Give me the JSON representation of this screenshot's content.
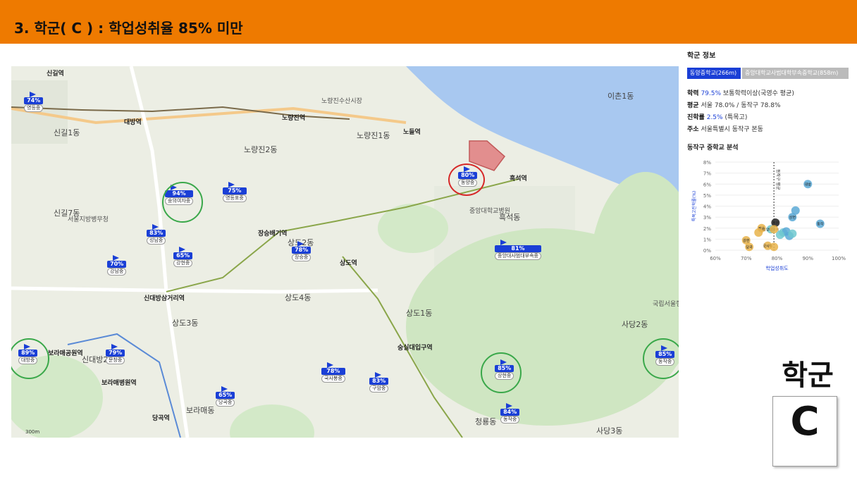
{
  "title": "3. 학군( C ) : 학업성취율 85% 미만",
  "map": {
    "scale_label": "300m",
    "places": [
      {
        "t": "신길역"
      },
      {
        "t": "대방역"
      },
      {
        "t": "노량진역"
      },
      {
        "t": "노들역"
      },
      {
        "t": "흑석역"
      },
      {
        "t": "장승배기역"
      },
      {
        "t": "상도역"
      },
      {
        "t": "신대방삼거리역"
      },
      {
        "t": "숭실대입구역"
      },
      {
        "t": "보라매공원역"
      },
      {
        "t": "보라매병원역"
      },
      {
        "t": "당곡역"
      },
      {
        "t": "신길1동"
      },
      {
        "t": "신길7동"
      },
      {
        "t": "노량진1동"
      },
      {
        "t": "노량진2동"
      },
      {
        "t": "상도2동"
      },
      {
        "t": "상도3동"
      },
      {
        "t": "상도4동"
      },
      {
        "t": "상도1동"
      },
      {
        "t": "흑석동"
      },
      {
        "t": "사당2동"
      },
      {
        "t": "사당3동"
      },
      {
        "t": "청룡동"
      },
      {
        "t": "보라매동"
      },
      {
        "t": "신대방2동"
      },
      {
        "t": "이촌1동"
      },
      {
        "t": "국립서울현충원"
      },
      {
        "t": "서울지방병무청"
      },
      {
        "t": "중앙대학교병원"
      },
      {
        "t": "노량진수산시장"
      }
    ],
    "schools": [
      {
        "pct": "74%",
        "name": "영등중"
      },
      {
        "pct": "94%",
        "name": "숭의여자중"
      },
      {
        "pct": "75%",
        "name": "영등포중"
      },
      {
        "pct": "83%",
        "name": "성남중"
      },
      {
        "pct": "65%",
        "name": "강현중"
      },
      {
        "pct": "70%",
        "name": "강남중"
      },
      {
        "pct": "78%",
        "name": "장승중"
      },
      {
        "pct": "80%",
        "name": "동양중"
      },
      {
        "pct": "81%",
        "name": "중앙대사범대부속중"
      },
      {
        "pct": "89%",
        "name": "대방중"
      },
      {
        "pct": "79%",
        "name": "문창중"
      },
      {
        "pct": "65%",
        "name": "당곡중"
      },
      {
        "pct": "78%",
        "name": "국사봉중"
      },
      {
        "pct": "83%",
        "name": "구암중"
      },
      {
        "pct": "85%",
        "name": "상현중"
      },
      {
        "pct": "84%",
        "name": "동작중"
      },
      {
        "pct": "85%",
        "name": "동작중"
      }
    ]
  },
  "panel": {
    "heading": "학군 정보",
    "tab_active": "동양중학교(266m)",
    "tab_inactive": "중앙대학교사범대학부속중학교(858m)",
    "row1_label": "학력",
    "row1_value": "79.5%",
    "row1_rest": "보통학력이상(국영수 평균)",
    "row2_label": "평균",
    "row2_rest": "서울 78.0% / 동작구 78.8%",
    "row3_label": "진학률",
    "row3_value": "2.5%",
    "row3_rest": "(특목고)",
    "row4_label": "주소",
    "row4_rest": "서울특별시 동작구 본동",
    "scatter_title": "동작구 중학교 분석"
  },
  "chart_data": {
    "type": "scatter",
    "title": "동작구 중학교 분석",
    "xlabel": "학업성취도",
    "ylabel": "특목고진학률(%)",
    "xlim": [
      60,
      100
    ],
    "ylim": [
      0,
      8
    ],
    "x_ticks": [
      "60%",
      "70%",
      "80%",
      "90%",
      "100%"
    ],
    "y_ticks": [
      "0%",
      "1%",
      "2%",
      "3%",
      "4%",
      "5%",
      "6%",
      "7%",
      "8%"
    ],
    "reference_label": "동작구 평균",
    "reference_x": 79,
    "points": [
      {
        "x": 90,
        "y": 6.0,
        "label": "대방",
        "color": "#5aa9d6"
      },
      {
        "x": 86,
        "y": 3.6,
        "label": "",
        "color": "#5aa9d6"
      },
      {
        "x": 85,
        "y": 3.0,
        "label": "상현",
        "color": "#5aa9d6"
      },
      {
        "x": 94,
        "y": 2.4,
        "label": "동작",
        "color": "#5aa9d6"
      },
      {
        "x": 79.5,
        "y": 2.5,
        "label": "동양",
        "color": "#222222"
      },
      {
        "x": 78,
        "y": 1.9,
        "label": "중앙대부속",
        "color": "#6fc8cf"
      },
      {
        "x": 82,
        "y": 1.6,
        "label": "",
        "color": "#6fc8cf"
      },
      {
        "x": 83,
        "y": 1.7,
        "label": "",
        "color": "#5aa9d6"
      },
      {
        "x": 84,
        "y": 1.3,
        "label": "",
        "color": "#5aa9d6"
      },
      {
        "x": 85,
        "y": 1.5,
        "label": "",
        "color": "#6fc8cf"
      },
      {
        "x": 81,
        "y": 1.4,
        "label": "",
        "color": "#6fc8cf"
      },
      {
        "x": 79,
        "y": 1.9,
        "label": "",
        "color": "#e8b34a"
      },
      {
        "x": 75,
        "y": 2.0,
        "label": "장승",
        "color": "#e8b34a"
      },
      {
        "x": 74,
        "y": 1.6,
        "label": "",
        "color": "#e8b34a"
      },
      {
        "x": 70,
        "y": 0.9,
        "label": "강현",
        "color": "#e8b34a"
      },
      {
        "x": 71,
        "y": 0.3,
        "label": "당곡",
        "color": "#e8b34a"
      },
      {
        "x": 77,
        "y": 0.4,
        "label": "국사봉",
        "color": "#e8b34a"
      },
      {
        "x": 79,
        "y": 0.3,
        "label": "",
        "color": "#e8b34a"
      }
    ]
  },
  "badge": {
    "text": "학군",
    "letter": "C"
  }
}
